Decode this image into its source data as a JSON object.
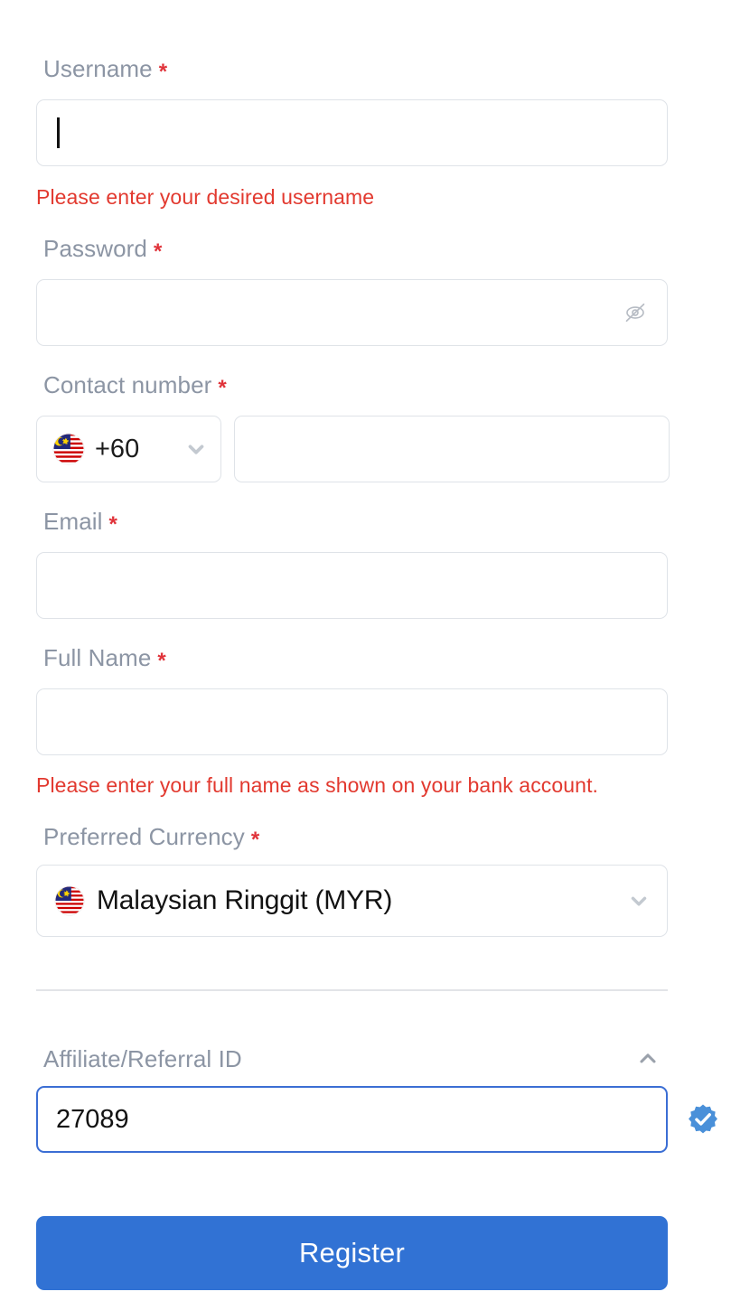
{
  "form": {
    "fields": {
      "username": {
        "label": "Username",
        "required_mark": "*",
        "value": "",
        "placeholder": "",
        "error": "Please enter your desired username"
      },
      "password": {
        "label": "Password",
        "required_mark": "*",
        "value": "",
        "placeholder": "",
        "toggle_icon": "eye-off-icon"
      },
      "contact_number": {
        "label": "Contact number",
        "required_mark": "*",
        "country_flag": "malaysia-flag-icon",
        "dial_code": "+60",
        "dropdown_icon": "chevron-down-icon",
        "value": "",
        "placeholder": ""
      },
      "email": {
        "label": "Email",
        "required_mark": "*",
        "value": "",
        "placeholder": ""
      },
      "full_name": {
        "label": "Full Name",
        "required_mark": "*",
        "value": "",
        "placeholder": "",
        "error": "Please enter your full name as shown on your bank account."
      },
      "preferred_currency": {
        "label": "Preferred Currency",
        "required_mark": "*",
        "selected_flag": "malaysia-flag-icon",
        "selected": "Malaysian Ringgit (MYR)",
        "dropdown_icon": "chevron-down-icon"
      },
      "affiliate_referral_id": {
        "label": "Affiliate/Referral ID",
        "collapse_icon": "chevron-up-icon",
        "value": "27089",
        "placeholder": "",
        "status_icon": "verified-badge-icon"
      }
    },
    "submit": {
      "label": "Register"
    }
  },
  "colors": {
    "label_gray": "#8c95a4",
    "error_red": "#e2392f",
    "required_star_red": "#e0333a",
    "border_gray": "#dfe3e8",
    "focus_blue": "#3b6ed4",
    "button_blue": "#3172d4",
    "verified_blue": "#4a90d9",
    "divider_gray": "#e2e4e8",
    "text_black": "#121212"
  }
}
